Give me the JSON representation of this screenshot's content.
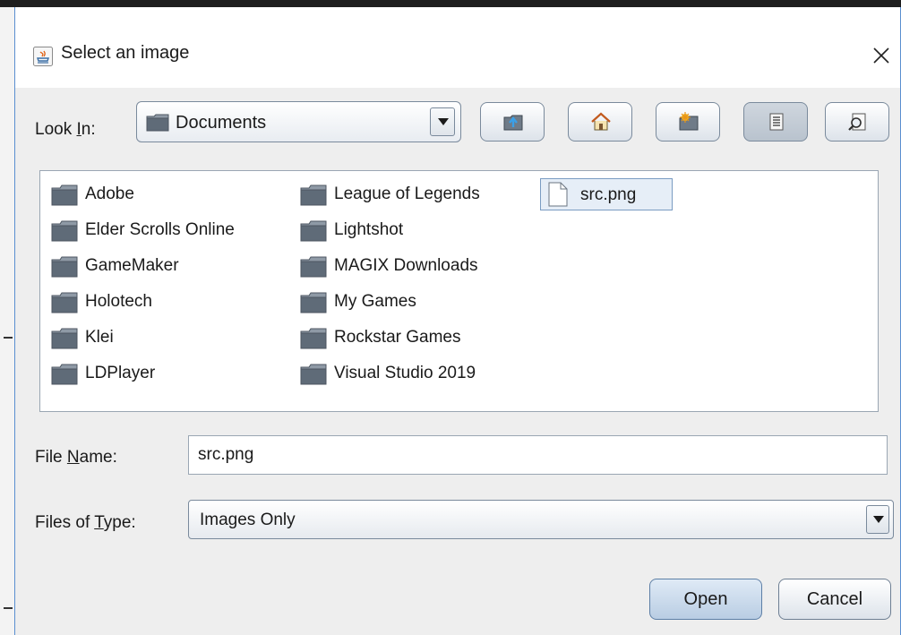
{
  "dialog": {
    "title": "Select an image",
    "close_glyph": "×"
  },
  "look_in": {
    "label_prefix": "Look ",
    "label_mnemonic": "I",
    "label_suffix": "n:",
    "value": "Documents"
  },
  "toolbar": {
    "buttons": [
      {
        "name": "up-one-level-icon"
      },
      {
        "name": "home-icon"
      },
      {
        "name": "create-new-folder-icon"
      },
      {
        "name": "list-view-icon",
        "active": true
      },
      {
        "name": "details-view-icon"
      }
    ]
  },
  "files": {
    "col1": [
      "Adobe",
      "Elder Scrolls Online",
      "GameMaker",
      "Holotech",
      "Klei",
      "LDPlayer"
    ],
    "col2": [
      "League of Legends",
      "Lightshot",
      "MAGIX Downloads",
      "My Games",
      "Rockstar Games",
      "Visual Studio 2019"
    ],
    "col3": [
      "src.png"
    ],
    "selected": "src.png"
  },
  "file_name": {
    "label_prefix": "File ",
    "label_mnemonic": "N",
    "label_suffix": "ame:",
    "value": "src.png"
  },
  "file_type": {
    "label_prefix": "Files of ",
    "label_mnemonic": "T",
    "label_suffix": "ype:",
    "value": "Images Only"
  },
  "actions": {
    "open_label": "Open",
    "cancel_label": "Cancel"
  },
  "colors": {
    "folder_fill": "#5f6b78",
    "selection_bg": "#e6eef7",
    "selection_border": "#7a9cc2",
    "window_border": "#5a8fd0"
  }
}
